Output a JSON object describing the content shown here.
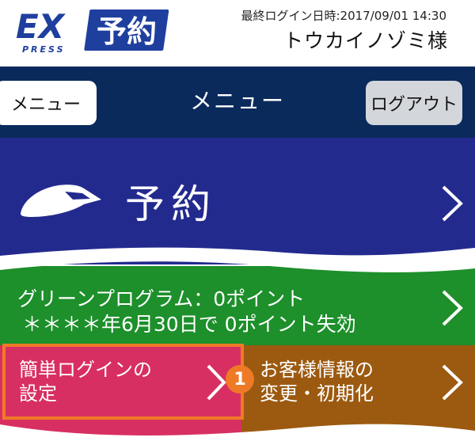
{
  "header": {
    "logo_text_ex": "EX",
    "logo_text_yoyaku": "予約",
    "logo_text_press": "PRESS",
    "last_login": "最終ログイン日時:2017/09/01 14:30",
    "username": "トウカイノゾミ様"
  },
  "navbar": {
    "menu_button": "メニュー",
    "title": "メニュー",
    "logout_button": "ログアウト"
  },
  "reserve": {
    "label": "予約"
  },
  "green_program": {
    "line1": "グリーンプログラム：0ポイント",
    "line2": "＊＊＊＊年6月30日で 0ポイント失効"
  },
  "simple_login": {
    "label": "簡単ログインの\n設定",
    "badge": "1"
  },
  "customer_info": {
    "label": "お客様情報の\n変更・初期化"
  },
  "colors": {
    "navbar": "#0a2a5c",
    "reserve": "#232a8e",
    "green": "#1d8f2b",
    "pink": "#d82f62",
    "brown": "#9c5a10",
    "highlight": "#ef7a26"
  }
}
